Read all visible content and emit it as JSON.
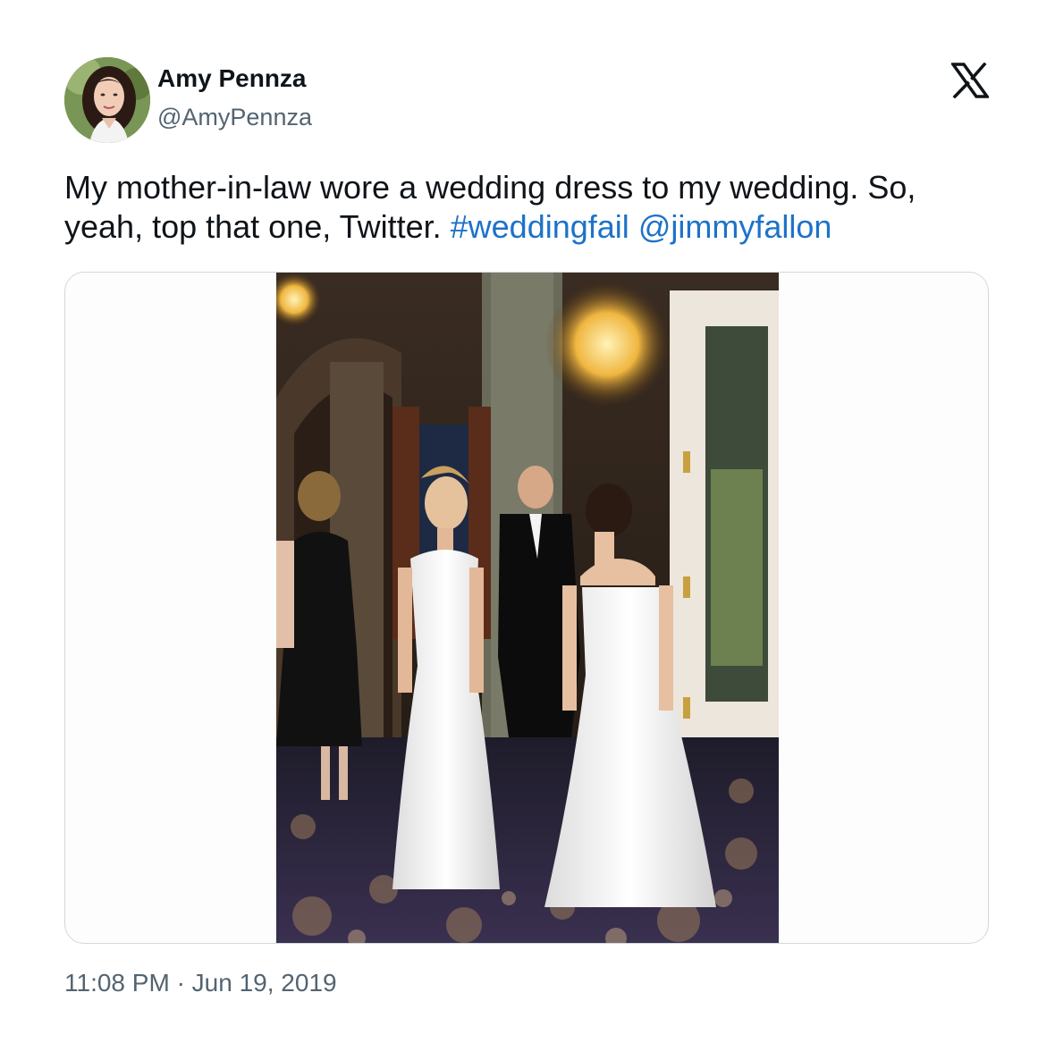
{
  "author": {
    "display_name": "Amy Pennza",
    "handle": "@AmyPennza"
  },
  "platform_icon": "x-logo-icon",
  "tweet": {
    "text": "My mother-in-law wore a wedding dress to my wedding. So, yeah, top that one, Twitter.",
    "hashtag": "#weddingfail",
    "mention": "@jimmyfallon",
    "link_color": "#1d72c8"
  },
  "meta": {
    "time": "11:08 PM",
    "separator": "·",
    "date": "Jun 19, 2019"
  },
  "colors": {
    "text_primary": "#0f1419",
    "text_secondary": "#536471",
    "border": "#cfd9de"
  }
}
